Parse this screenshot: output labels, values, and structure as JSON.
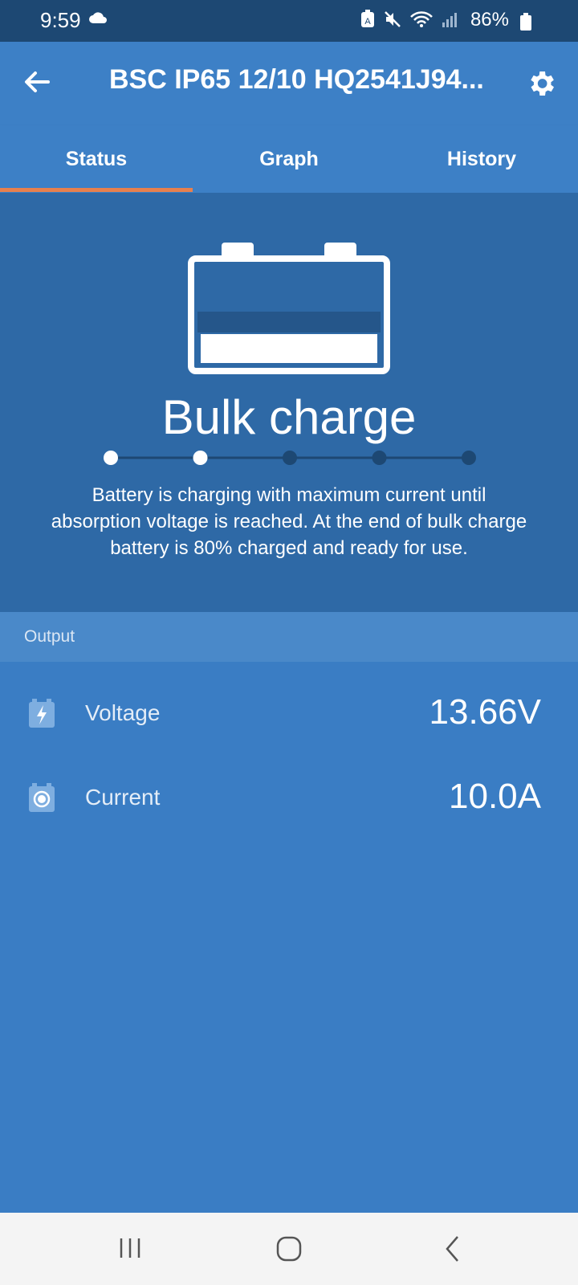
{
  "status_bar": {
    "time": "9:59",
    "battery_percent": "86%",
    "icons": [
      "cloud-icon",
      "auto-icon",
      "mute-icon",
      "wifi-icon",
      "signal-icon",
      "battery-icon"
    ]
  },
  "app_bar": {
    "title": "BSC IP65 12/10 HQ2541J94...",
    "back_icon": "arrow-left-icon",
    "settings_icon": "gear-icon"
  },
  "tabs": [
    {
      "label": "Status",
      "active": true
    },
    {
      "label": "Graph",
      "active": false
    },
    {
      "label": "History",
      "active": false
    }
  ],
  "charge_state": {
    "title": "Bulk charge",
    "description": "Battery is charging with maximum current until absorption voltage is reached. At the end of bulk charge battery is 80% charged and ready for use.",
    "steps_total": 5,
    "steps_completed": 2
  },
  "output": {
    "section_label": "Output",
    "rows": [
      {
        "label": "Voltage",
        "value": "13.66V",
        "icon": "battery-bolt-icon"
      },
      {
        "label": "Current",
        "value": "10.0A",
        "icon": "battery-dot-icon"
      }
    ]
  },
  "colors": {
    "primary": "#3d80c6",
    "hero_bg": "#2e69a6",
    "status_bar": "#1d4873",
    "tab_indicator": "#e8804d"
  }
}
